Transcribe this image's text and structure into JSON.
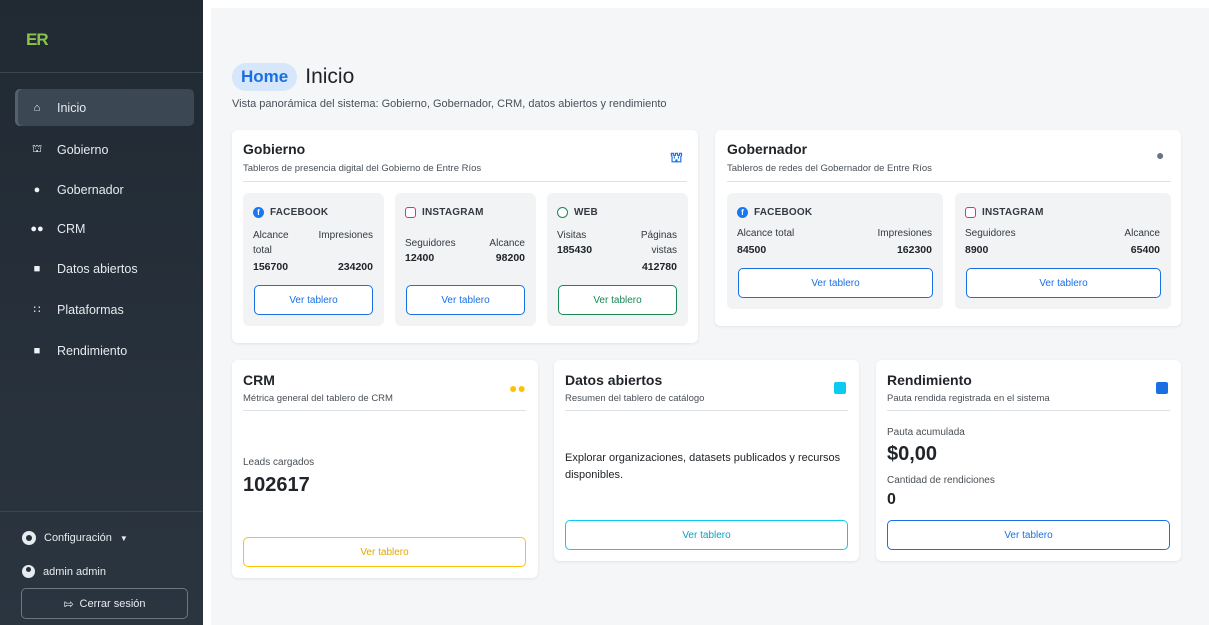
{
  "sidebar": {
    "logo": "ER",
    "items": [
      {
        "label": "Inicio",
        "icon": "home-icon"
      },
      {
        "label": "Gobierno",
        "icon": "bank-icon"
      },
      {
        "label": "Gobernador",
        "icon": "person-icon"
      },
      {
        "label": "CRM",
        "icon": "people-icon"
      },
      {
        "label": "Datos abiertos",
        "icon": "chart-icon"
      },
      {
        "label": "Plataformas",
        "icon": "grid-icon"
      },
      {
        "label": "Rendimiento",
        "icon": "bar-chart-icon"
      }
    ],
    "config_label": "Configuración",
    "user_label": "admin admin",
    "logout_label": "Cerrar sesión"
  },
  "header": {
    "badge": "Home",
    "title": "Inicio",
    "subtitle": "Vista panorámica del sistema: Gobierno, Gobernador, CRM, datos abiertos y rendimiento"
  },
  "gobierno": {
    "title": "Gobierno",
    "subtitle": "Tableros de presencia digital del Gobierno de Entre Ríos",
    "facebook": {
      "label": "FACEBOOK",
      "m1_label": "Alcance total",
      "m1_value": "156700",
      "m2_label": "Impresiones",
      "m2_value": "234200",
      "button": "Ver tablero"
    },
    "instagram": {
      "label": "INSTAGRAM",
      "m1_label": "Seguidores",
      "m1_value": "12400",
      "m2_label": "Alcance",
      "m2_value": "98200",
      "button": "Ver tablero"
    },
    "web": {
      "label": "WEB",
      "m1_label": "Visitas",
      "m1_value": "185430",
      "m2_label": "Páginas vistas",
      "m2_value": "412780",
      "button": "Ver tablero"
    }
  },
  "gobernador": {
    "title": "Gobernador",
    "subtitle": "Tableros de redes del Gobernador de Entre Ríos",
    "facebook": {
      "label": "FACEBOOK",
      "m1_label": "Alcance total",
      "m1_value": "84500",
      "m2_label": "Impresiones",
      "m2_value": "162300",
      "button": "Ver tablero"
    },
    "instagram": {
      "label": "INSTAGRAM",
      "m1_label": "Seguidores",
      "m1_value": "8900",
      "m2_label": "Alcance",
      "m2_value": "65400",
      "button": "Ver tablero"
    }
  },
  "crm": {
    "title": "CRM",
    "subtitle": "Métrica general del tablero de CRM",
    "metric_label": "Leads cargados",
    "metric_value": "102617",
    "button": "Ver tablero"
  },
  "datos": {
    "title": "Datos abiertos",
    "subtitle": "Resumen del tablero de catálogo",
    "body": "Explorar organizaciones, datasets publicados y recursos disponibles.",
    "button": "Ver tablero"
  },
  "rendimiento": {
    "title": "Rendimiento",
    "subtitle": "Pauta rendida registrada en el sistema",
    "m1_label": "Pauta acumulada",
    "m1_value": "$0,00",
    "m2_label": "Cantidad de rendiciones",
    "m2_value": "0",
    "button": "Ver tablero"
  },
  "colors": {
    "accent": "#1a6fe3",
    "sidebar": "#212a33",
    "crm_icon": "#ffc107",
    "datos_icon": "#0dcaf0",
    "web": "#198754"
  }
}
